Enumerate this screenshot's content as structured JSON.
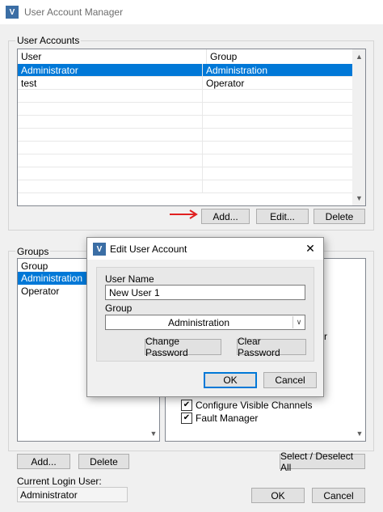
{
  "window": {
    "title": "User Account Manager",
    "icon": "app-logo-icon"
  },
  "user_accounts": {
    "legend": "User Accounts",
    "columns": [
      "User",
      "Group"
    ],
    "rows": [
      {
        "user": "Administrator",
        "group": "Administration",
        "selected": true
      },
      {
        "user": "test",
        "group": "Operator",
        "selected": false
      }
    ],
    "buttons": {
      "add": "Add...",
      "edit": "Edit...",
      "delete": "Delete"
    }
  },
  "groups": {
    "legend": "Groups",
    "header": "Group",
    "items": [
      "Administration",
      "Operator"
    ],
    "selected_index": 0,
    "buttons": {
      "add": "Add...",
      "delete": "Delete"
    }
  },
  "permissions": {
    "visible_items": [
      {
        "label": "Configure Visible Channels",
        "checked": true
      },
      {
        "label": "Fault Manager",
        "checked": true
      }
    ],
    "select_all_label": "Select / Deselect All",
    "partial_char": "r"
  },
  "current_login": {
    "label": "Current Login User:",
    "value": "Administrator"
  },
  "footer": {
    "ok": "OK",
    "cancel": "Cancel"
  },
  "edit_dialog": {
    "title": "Edit User Account",
    "user_name_label": "User Name",
    "user_name_value": "New User 1",
    "group_label": "Group",
    "group_value": "Administration",
    "change_password": "Change Password",
    "clear_password": "Clear Password",
    "ok": "OK",
    "cancel": "Cancel",
    "close_glyph": "✕"
  },
  "colors": {
    "accent": "#0078d7",
    "arrow": "#e02020"
  }
}
